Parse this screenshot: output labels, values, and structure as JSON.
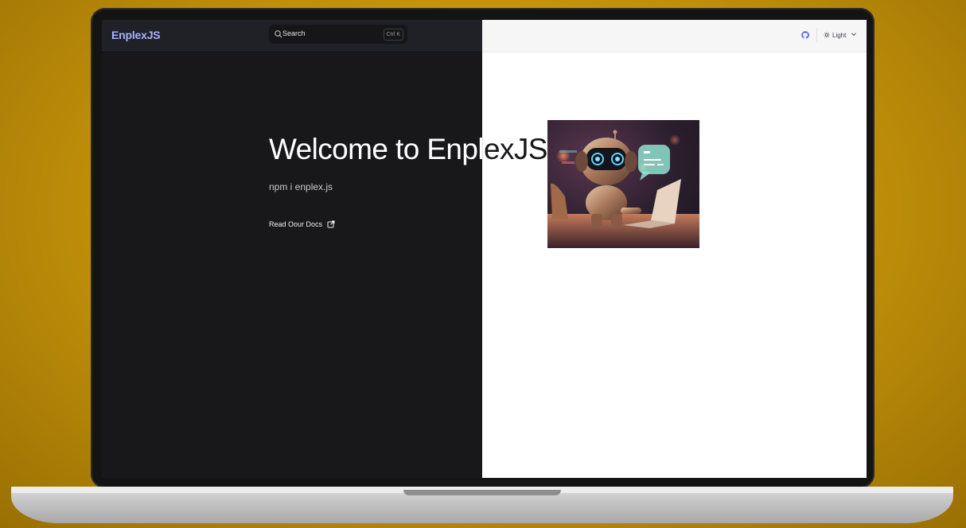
{
  "navbar": {
    "brand": "EnplexJS",
    "search": {
      "placeholder": "Search",
      "shortcut": "Ctrl K"
    },
    "theme_toggle_label": "Light"
  },
  "hero": {
    "title": "Welcome to EnplexJS",
    "tagline": "npm i enplex.js",
    "docs_link_label": "Read Oour Docs"
  },
  "colors": {
    "background": "#c99a0d",
    "dark_page": "#18181b",
    "dark_navbar": "#202127",
    "light_page": "#ffffff",
    "brand": "#a8b1ff",
    "github_icon": "#5661e6"
  },
  "icons": {
    "search": "search-icon",
    "github": "github-icon",
    "theme": "sun-icon",
    "dropdown": "chevron-down-icon",
    "docs": "external-link-icon"
  }
}
